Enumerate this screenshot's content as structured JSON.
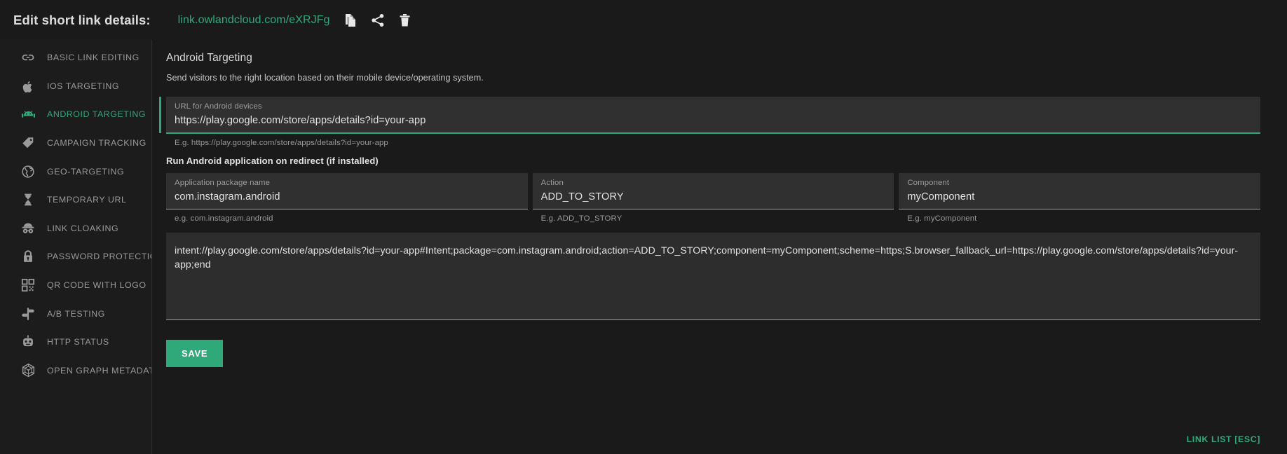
{
  "header": {
    "title": "Edit short link details:",
    "short_link": "link.owlandcloud.com/eXRJFg",
    "icons": [
      {
        "name": "copy-icon",
        "label": "Copy"
      },
      {
        "name": "share-icon",
        "label": "Share"
      },
      {
        "name": "delete-icon",
        "label": "Delete"
      }
    ]
  },
  "sidebar": {
    "items": [
      {
        "label": "BASIC LINK EDITING",
        "icon": "link-icon",
        "active": false
      },
      {
        "label": "IOS TARGETING",
        "icon": "apple-icon",
        "active": false
      },
      {
        "label": "ANDROID TARGETING",
        "icon": "android-icon",
        "active": true
      },
      {
        "label": "CAMPAIGN TRACKING",
        "icon": "tag-icon",
        "active": false
      },
      {
        "label": "GEO-TARGETING",
        "icon": "globe-icon",
        "active": false
      },
      {
        "label": "TEMPORARY URL",
        "icon": "hourglass-icon",
        "active": false
      },
      {
        "label": "LINK CLOAKING",
        "icon": "spy-icon",
        "active": false
      },
      {
        "label": "PASSWORD PROTECTION",
        "icon": "lock-icon",
        "active": false
      },
      {
        "label": "QR CODE WITH LOGO",
        "icon": "qr-code-icon",
        "active": false
      },
      {
        "label": "A/B TESTING",
        "icon": "signpost-icon",
        "active": false
      },
      {
        "label": "HTTP STATUS",
        "icon": "robot-icon",
        "active": false
      },
      {
        "label": "OPEN GRAPH METADATA",
        "icon": "web-icon",
        "active": false
      }
    ]
  },
  "main": {
    "section_title": "Android Targeting",
    "section_subtitle": "Send visitors to the right location based on their mobile device/operating system.",
    "url_field": {
      "label": "URL for Android devices",
      "value": "https://play.google.com/store/apps/details?id=your-app",
      "hint": "E.g. https://play.google.com/store/apps/details?id=your-app"
    },
    "run_app_heading": "Run Android application on redirect (if installed)",
    "package_field": {
      "label": "Application package name",
      "value": "com.instagram.android",
      "hint": "e.g. com.instagram.android"
    },
    "action_field": {
      "label": "Action",
      "value": "ADD_TO_STORY",
      "hint": "E.g. ADD_TO_STORY"
    },
    "component_field": {
      "label": "Component",
      "value": "myComponent",
      "hint": "E.g. myComponent"
    },
    "intent_preview": "intent://play.google.com/store/apps/details?id=your-app#Intent;package=com.instagram.android;action=ADD_TO_STORY;component=myComponent;scheme=https;S.browser_fallback_url=https://play.google.com/store/apps/details?id=your-app;end",
    "save_label": "SAVE",
    "link_list_label": "LINK LIST [ESC]"
  },
  "colors": {
    "accent": "#2fa97a",
    "background": "#1a1a1a",
    "sidebar_bg": "#1c1c1c",
    "field_bg": "#303030"
  }
}
